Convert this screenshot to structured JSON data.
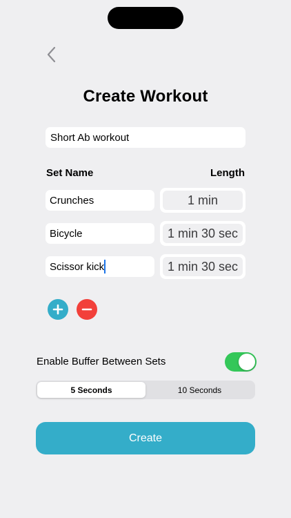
{
  "page": {
    "title": "Create Workout",
    "workout_name": "Short Ab workout"
  },
  "sets_header": {
    "name_label": "Set Name",
    "length_label": "Length"
  },
  "sets": [
    {
      "name": "Crunches",
      "length": "1 min"
    },
    {
      "name": "Bicycle",
      "length": "1 min 30 sec"
    },
    {
      "name": "Scissor kick",
      "length": "1 min 30 sec"
    }
  ],
  "icons": {
    "back": "chevron-left-icon",
    "add": "plus-icon",
    "remove": "minus-icon"
  },
  "buffer": {
    "label": "Enable Buffer Between Sets",
    "enabled": true,
    "options": [
      "5 Seconds",
      "10 Seconds"
    ],
    "selected": "5 Seconds"
  },
  "create_button": {
    "label": "Create"
  },
  "colors": {
    "accent": "#34adc9",
    "remove": "#f2403a",
    "toggle_on": "#34c759",
    "background": "#efeff1"
  }
}
